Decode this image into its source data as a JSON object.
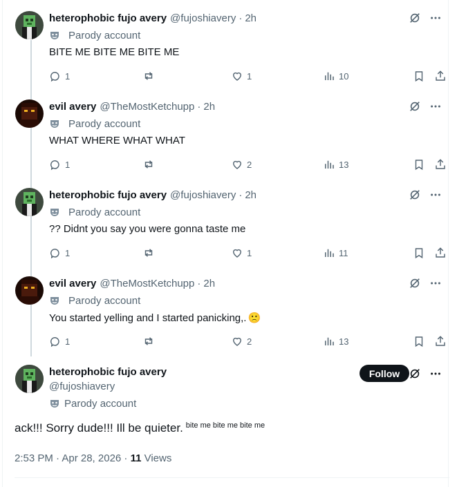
{
  "parody_label": "Parody account",
  "replies": [
    {
      "avatar": "green-avatar",
      "name": "heterophobic fujo avery",
      "handle": "@fujoshiavery",
      "time": "2h",
      "text": "BITE ME BITE ME BITE ME",
      "emoji": "",
      "stats": {
        "replies": "1",
        "retweets": "",
        "likes": "1",
        "views": "10"
      }
    },
    {
      "avatar": "evil-avatar",
      "name": "evil avery",
      "handle": "@TheMostKetchupp",
      "time": "2h",
      "text": "WHAT WHERE WHAT WHAT",
      "emoji": "",
      "stats": {
        "replies": "1",
        "retweets": "",
        "likes": "2",
        "views": "13"
      }
    },
    {
      "avatar": "green-avatar",
      "name": "heterophobic fujo avery",
      "handle": "@fujoshiavery",
      "time": "2h",
      "text": "?? Didnt you say you were gonna taste me",
      "emoji": "",
      "stats": {
        "replies": "1",
        "retweets": "",
        "likes": "1",
        "views": "11"
      }
    },
    {
      "avatar": "evil-avatar",
      "name": "evil avery",
      "handle": "@TheMostKetchupp",
      "time": "2h",
      "text": "You started yelling and I started panicking,.",
      "emoji": "🙁",
      "stats": {
        "replies": "1",
        "retweets": "",
        "likes": "2",
        "views": "13"
      }
    }
  ],
  "main_tweet": {
    "name": "heterophobic fujo avery",
    "handle": "@fujoshiavery",
    "follow_label": "Follow",
    "text": "ack!!! Sorry dude!!! Ill be quieter.",
    "small_text": "bite me bite me bite me",
    "timestamp": "2:53 PM · Apr 28, 2026 · ",
    "views_count": "11",
    "views_label": " Views"
  },
  "colors": {
    "text": "#0f1419",
    "secondary": "#536471",
    "thread_line": "#cfd9de",
    "follow_bg": "#0f1419"
  }
}
